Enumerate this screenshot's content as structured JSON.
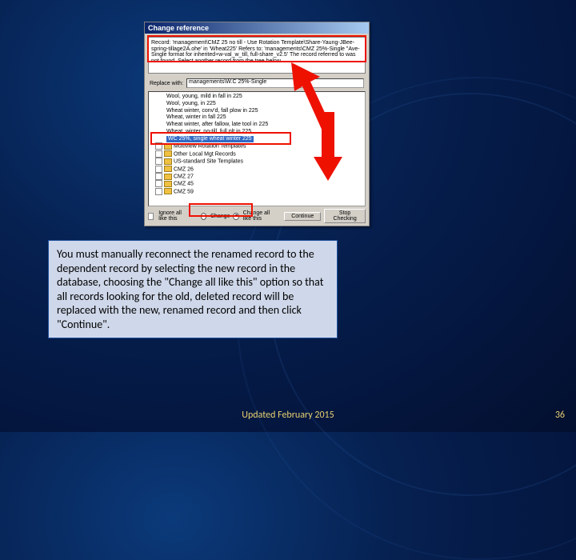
{
  "dialog": {
    "title": "Change reference",
    "info_text": "Record: 'management\\CMZ 25 no till - Use Rotation Template\\Share-Yaung-JBee-spring-tillage2A.ohe' in 'Wheat225'\nRefers to: 'managements\\CMZ 25%-Single \"Ave-Single format for inherited+w-val_w_till, full-share_v2.5'\nThe record referred to was not found. Select another record from the tree below.",
    "replace_label": "Replace with:",
    "replace_value": "managements\\W.C 25%-Single",
    "tree_items": [
      "Wool, young, mild in fall in 225",
      "Wool, young, in 225",
      "Wheat winter, conv'd, fall plow in 225",
      "Wheat, winter in fall 225",
      "Wheat winter, after fallow, late tool in 225",
      "Wheat, winter, no-till, full plt in 225"
    ],
    "tree_selected": "WC 25%, single wheat winter 225",
    "folders": [
      "Multiview Rotation Templates",
      "Other Local Mgt Records",
      "US-standard Site Templates",
      "CMZ 26",
      "CMZ 27",
      "CMZ 45",
      "CMZ 59"
    ],
    "ignore_label": "Ignore all like this",
    "change_label": "Change",
    "change_all_label": "Change all like this",
    "continue_btn": "Continue",
    "stop_btn": "Stop Checking"
  },
  "caption": "You must manually reconnect the renamed record to the dependent record by selecting the new record in the database, choosing the \"Change all like this\" option so that all records looking for the old, deleted record will be replaced with the new, renamed record and then click \"Continue\".",
  "footer": "Updated February 2015",
  "page": "36"
}
